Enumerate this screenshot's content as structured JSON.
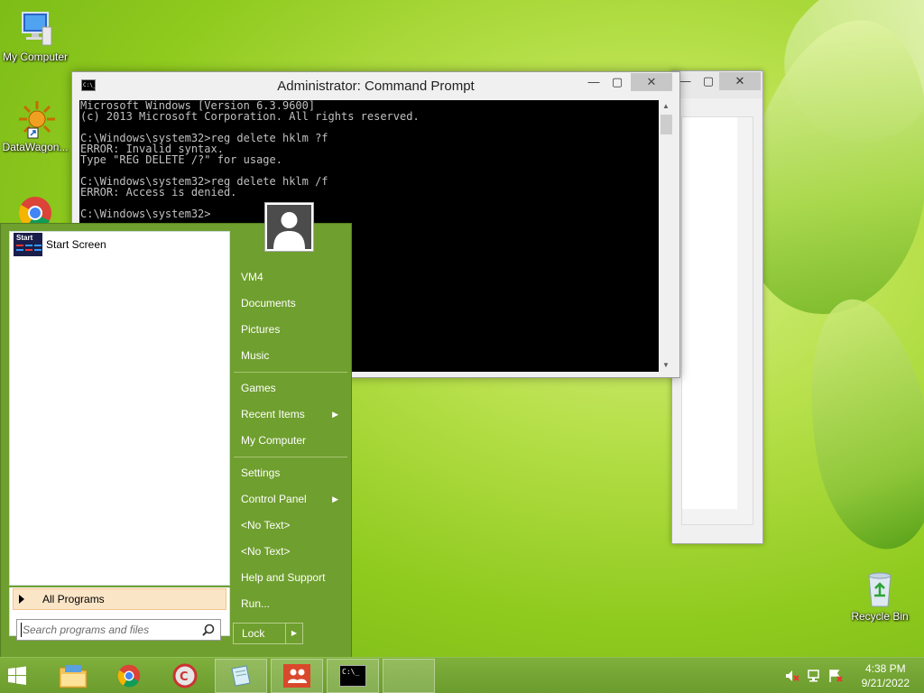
{
  "desktop": {
    "icons": [
      {
        "label": "My Computer"
      },
      {
        "label": "DataWagon..."
      },
      {
        "label": "Recycle Bin"
      }
    ]
  },
  "cmd_window": {
    "title": "Administrator: Command Prompt",
    "icon_text": "C:\\_",
    "buttons": {
      "minimize": "—",
      "maximize": "▢",
      "close": "✕"
    },
    "lines": [
      "Microsoft Windows [Version 6.3.9600]",
      "(c) 2013 Microsoft Corporation. All rights reserved.",
      "",
      "C:\\Windows\\system32>reg delete hklm ?f",
      "ERROR: Invalid syntax.",
      "Type \"REG DELETE /?\" for usage.",
      "",
      "C:\\Windows\\system32>reg delete hklm /f",
      "ERROR: Access is denied.",
      "",
      "C:\\Windows\\system32>"
    ]
  },
  "background_window": {
    "buttons": {
      "minimize": "—",
      "maximize": "▢",
      "close": "✕"
    }
  },
  "start_menu": {
    "programs": [
      {
        "label": "Start Screen",
        "tile_text": "Start"
      }
    ],
    "all_programs": "All Programs",
    "search_placeholder": "Search programs and files",
    "right_items": {
      "group1": [
        "VM4",
        "Documents",
        "Pictures",
        "Music"
      ],
      "group2": [
        {
          "label": "Games",
          "submenu": false
        },
        {
          "label": "Recent Items",
          "submenu": true
        },
        {
          "label": "My Computer",
          "submenu": false
        }
      ],
      "group3": [
        {
          "label": "Settings",
          "submenu": false
        },
        {
          "label": "Control Panel",
          "submenu": true
        },
        {
          "label": "<No Text>",
          "submenu": false
        },
        {
          "label": "<No Text>",
          "submenu": false
        },
        {
          "label": "Help and Support",
          "submenu": false
        },
        {
          "label": "Run...",
          "submenu": false
        }
      ]
    },
    "lock_label": "Lock",
    "lock_arrow": "▶",
    "submenu_arrow": "▶"
  },
  "taskbar": {
    "items": [
      "start-button",
      "file-explorer",
      "chrome",
      "ccleaner",
      "notepad",
      "people",
      "command-prompt",
      "blank"
    ],
    "cmd_icon_text": "C:\\_",
    "clock": {
      "time": "4:38 PM",
      "date": "9/21/2022"
    }
  }
}
